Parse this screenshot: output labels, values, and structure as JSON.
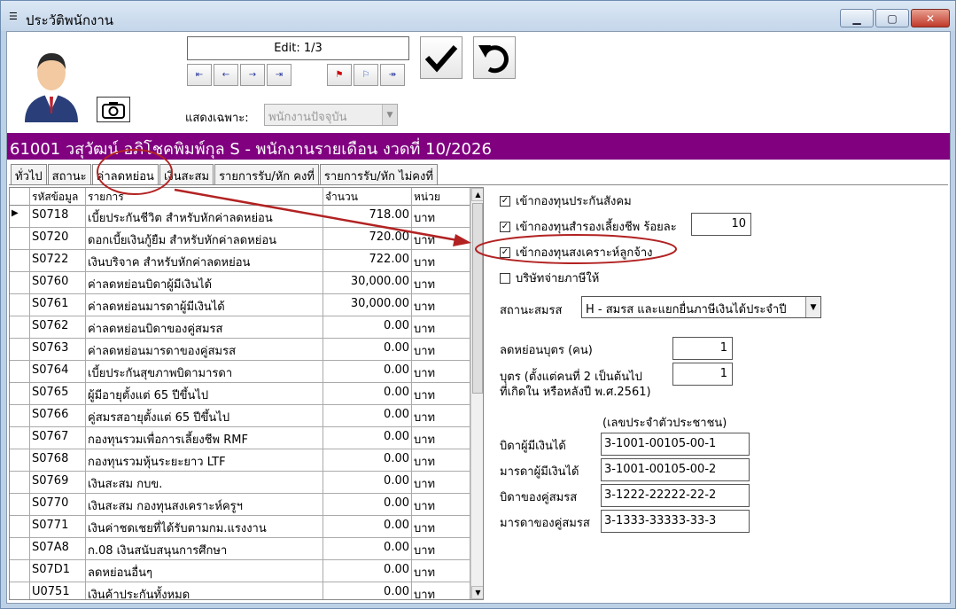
{
  "window": {
    "title": "ประวัติพนักงาน",
    "icon": "list-icon",
    "buttons": {
      "minimize": "▁",
      "maximize": "▢",
      "close": "✕"
    }
  },
  "toolbar": {
    "record_status": "Edit: 1/3",
    "nav_buttons": [
      "first",
      "prev",
      "next",
      "last",
      "flag",
      "flag-edit",
      "jump"
    ],
    "confirm_icon": "checkmark-icon",
    "undo_icon": "undo-icon",
    "show_label": "แสดงเฉพาะ:",
    "show_value": "พนักงานปัจจุบัน"
  },
  "employee": {
    "header": "61001 วสุวัฒน์ อภิโชคพิมพ์กุล  S - พนักงานรายเดือน  งวดที่ 10/2026"
  },
  "tabs": [
    "ทั่วไป",
    "สถานะ",
    "ค่าลดหย่อน",
    "เงินสะสม",
    "รายการรับ/หัก คงที่",
    "รายการรับ/หัก ไม่คงที่"
  ],
  "active_tab": "ค่าลดหย่อน",
  "grid": {
    "headers": {
      "code": "รหัสข้อมูล",
      "desc": "รายการ",
      "amount": "จำนวน",
      "unit": "หน่วย"
    },
    "rows": [
      {
        "code": "S0718",
        "desc": "เบี้ยประกันชีวิต สำหรับหักค่าลดหย่อน",
        "amount": "718.00",
        "unit": "บาท"
      },
      {
        "code": "S0720",
        "desc": "ดอกเบี้ยเงินกู้ยืม สำหรับหักค่าลดหย่อน",
        "amount": "720.00",
        "unit": "บาท"
      },
      {
        "code": "S0722",
        "desc": "เงินบริจาค สำหรับหักค่าลดหย่อน",
        "amount": "722.00",
        "unit": "บาท"
      },
      {
        "code": "S0760",
        "desc": "ค่าลดหย่อนบิดาผู้มีเงินได้",
        "amount": "30,000.00",
        "unit": "บาท"
      },
      {
        "code": "S0761",
        "desc": "ค่าลดหย่อนมารดาผู้มีเงินได้",
        "amount": "30,000.00",
        "unit": "บาท"
      },
      {
        "code": "S0762",
        "desc": "ค่าลดหย่อนบิดาของคู่สมรส",
        "amount": "0.00",
        "unit": "บาท"
      },
      {
        "code": "S0763",
        "desc": "ค่าลดหย่อนมารดาของคู่สมรส",
        "amount": "0.00",
        "unit": "บาท"
      },
      {
        "code": "S0764",
        "desc": "เบี้ยประกันสุขภาพบิดามารดา",
        "amount": "0.00",
        "unit": "บาท"
      },
      {
        "code": "S0765",
        "desc": "ผู้มีอายุตั้งแต่ 65 ปีขึ้นไป",
        "amount": "0.00",
        "unit": "บาท"
      },
      {
        "code": "S0766",
        "desc": "คู่สมรสอายุตั้งแต่ 65 ปีขึ้นไป",
        "amount": "0.00",
        "unit": "บาท"
      },
      {
        "code": "S0767",
        "desc": "กองทุนรวมเพื่อการเลี้ยงชีพ RMF",
        "amount": "0.00",
        "unit": "บาท"
      },
      {
        "code": "S0768",
        "desc": "กองทุนรวมหุ้นระยะยาว LTF",
        "amount": "0.00",
        "unit": "บาท"
      },
      {
        "code": "S0769",
        "desc": "เงินสะสม กบข.",
        "amount": "0.00",
        "unit": "บาท"
      },
      {
        "code": "S0770",
        "desc": "เงินสะสม กองทุนสงเคราะห์ครูฯ",
        "amount": "0.00",
        "unit": "บาท"
      },
      {
        "code": "S0771",
        "desc": "เงินค่าชดเชยที่ได้รับตามกม.แรงงาน",
        "amount": "0.00",
        "unit": "บาท"
      },
      {
        "code": "S07A8",
        "desc": "ก.08 เงินสนับสนุนการศึกษา",
        "amount": "0.00",
        "unit": "บาท"
      },
      {
        "code": "S07D1",
        "desc": "ลดหย่อนอื่นๆ",
        "amount": "0.00",
        "unit": "บาท"
      },
      {
        "code": "U0751",
        "desc": "เงินค้าประกันทั้งหมด",
        "amount": "0.00",
        "unit": "บาท"
      }
    ]
  },
  "options": {
    "social_security": {
      "label": "เข้ากองทุนประกันสังคม",
      "checked": true
    },
    "provident_fund": {
      "label": "เข้ากองทุนสำรองเลี้ยงชีพ ร้อยละ",
      "checked": true,
      "value": "10"
    },
    "welfare_fund": {
      "label": "เข้ากองทุนสงเคราะห์ลูกจ้าง",
      "checked": true
    },
    "company_pays_tax": {
      "label": "บริษัทจ่ายภาษีให้",
      "checked": false
    }
  },
  "marital": {
    "label": "สถานะสมรส",
    "value": "H - สมรส และแยกยื่นภาษีเงินได้ประจำปี"
  },
  "children": {
    "label": "ลดหย่อนบุตร (คน)",
    "value": "1",
    "label2_line1": "บุตร (ตั้งแต่คนที่ 2 เป็นต้นไป",
    "label2_line2": "ที่เกิดใน หรือหลังปี พ.ศ.2561)",
    "value2": "1"
  },
  "ids": {
    "caption": "(เลขประจำตัวประชาชน)",
    "rows": [
      {
        "label": "บิดาผู้มีเงินได้",
        "value": "3-1001-00105-00-1"
      },
      {
        "label": "มารดาผู้มีเงินได้",
        "value": "3-1001-00105-00-2"
      },
      {
        "label": "บิดาของคู่สมรส",
        "value": "3-1222-22222-22-2"
      },
      {
        "label": "มารดาของคู่สมรส",
        "value": "3-1333-33333-33-3"
      }
    ]
  },
  "annotation_color": "#b22222",
  "header_color": "#800080"
}
